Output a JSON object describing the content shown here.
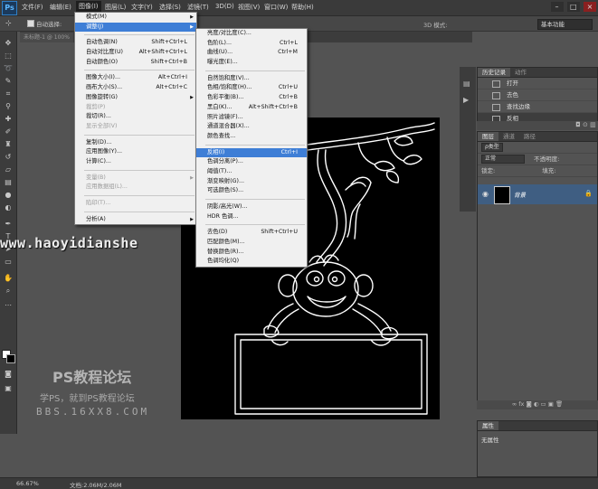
{
  "app": {
    "logo": "Ps"
  },
  "menubar": [
    "文件(F)",
    "编辑(E)",
    "图像(I)",
    "图层(L)",
    "文字(Y)",
    "选择(S)",
    "滤镜(T)",
    "3D(D)",
    "视图(V)",
    "窗口(W)",
    "帮助(H)"
  ],
  "window_controls": [
    "–",
    "□",
    "×"
  ],
  "options_bar": {
    "auto_select": "自动选择:",
    "mode_3d": "3D 模式:",
    "workspace": "基本功能"
  },
  "doc_tab": {
    "title": "未标题-1 @ 100%"
  },
  "image_menu": {
    "items": [
      {
        "label": "模式(M)",
        "shortcut": "",
        "submenu": true
      },
      {
        "label": "调整(J)",
        "shortcut": "",
        "submenu": true,
        "highlighted": true
      },
      {
        "sep": true
      },
      {
        "label": "自动色调(N)",
        "shortcut": "Shift+Ctrl+L"
      },
      {
        "label": "自动对比度(U)",
        "shortcut": "Alt+Shift+Ctrl+L"
      },
      {
        "label": "自动颜色(O)",
        "shortcut": "Shift+Ctrl+B"
      },
      {
        "sep": true
      },
      {
        "label": "图像大小(I)...",
        "shortcut": "Alt+Ctrl+I"
      },
      {
        "label": "画布大小(S)...",
        "shortcut": "Alt+Ctrl+C"
      },
      {
        "label": "图像旋转(G)",
        "shortcut": "",
        "submenu": true
      },
      {
        "label": "裁剪(P)",
        "shortcut": "",
        "disabled": true
      },
      {
        "label": "裁切(R)...",
        "shortcut": ""
      },
      {
        "label": "显示全部(V)",
        "shortcut": "",
        "disabled": true
      },
      {
        "sep": true
      },
      {
        "label": "复制(D)...",
        "shortcut": ""
      },
      {
        "label": "应用图像(Y)...",
        "shortcut": ""
      },
      {
        "label": "计算(C)...",
        "shortcut": ""
      },
      {
        "sep": true
      },
      {
        "label": "变量(B)",
        "shortcut": "",
        "submenu": true,
        "disabled": true
      },
      {
        "label": "应用数据组(L)...",
        "shortcut": "",
        "disabled": true
      },
      {
        "sep": true
      },
      {
        "label": "陷印(T)...",
        "shortcut": "",
        "disabled": true
      },
      {
        "sep": true
      },
      {
        "label": "分析(A)",
        "shortcut": "",
        "submenu": true
      }
    ]
  },
  "adjust_menu": {
    "items": [
      {
        "label": "亮度/对比度(C)...",
        "shortcut": ""
      },
      {
        "label": "色阶(L)...",
        "shortcut": "Ctrl+L"
      },
      {
        "label": "曲线(U)...",
        "shortcut": "Ctrl+M"
      },
      {
        "label": "曝光度(E)...",
        "shortcut": ""
      },
      {
        "sep": true
      },
      {
        "label": "自然饱和度(V)...",
        "shortcut": ""
      },
      {
        "label": "色相/饱和度(H)...",
        "shortcut": "Ctrl+U"
      },
      {
        "label": "色彩平衡(B)...",
        "shortcut": "Ctrl+B"
      },
      {
        "label": "黑白(K)...",
        "shortcut": "Alt+Shift+Ctrl+B"
      },
      {
        "label": "照片滤镜(F)...",
        "shortcut": ""
      },
      {
        "label": "通道混合器(X)...",
        "shortcut": ""
      },
      {
        "label": "颜色查找...",
        "shortcut": ""
      },
      {
        "sep": true
      },
      {
        "label": "反相(I)",
        "shortcut": "Ctrl+I",
        "highlighted": true
      },
      {
        "label": "色调分离(P)...",
        "shortcut": ""
      },
      {
        "label": "阈值(T)...",
        "shortcut": ""
      },
      {
        "label": "渐变映射(G)...",
        "shortcut": ""
      },
      {
        "label": "可选颜色(S)...",
        "shortcut": ""
      },
      {
        "sep": true
      },
      {
        "label": "阴影/高光(W)...",
        "shortcut": ""
      },
      {
        "label": "HDR 色调...",
        "shortcut": ""
      },
      {
        "sep": true
      },
      {
        "label": "去色(D)",
        "shortcut": "Shift+Ctrl+U"
      },
      {
        "label": "匹配颜色(M)...",
        "shortcut": ""
      },
      {
        "label": "替换颜色(R)...",
        "shortcut": ""
      },
      {
        "label": "色调均化(Q)",
        "shortcut": ""
      }
    ]
  },
  "history_panel": {
    "tabs": [
      "历史记录",
      "动作"
    ],
    "rows": [
      "打开",
      "去色",
      "查找边缘",
      "反相"
    ]
  },
  "layers_panel": {
    "tabs": [
      "图层",
      "通道",
      "路径"
    ],
    "kind_label": "ρ类型",
    "blend_mode": "正常",
    "opacity_label": "不透明度:",
    "lock_label": "锁定:",
    "fill_label": "填充:",
    "layer_name": "背景",
    "footer_icons": "∞  fx  ◙  ◐  ▭  ▣  🗑"
  },
  "properties_panel": {
    "title": "属性",
    "body": "无属性"
  },
  "status": {
    "zoom": "66.67%",
    "doc": "文档:2.06M/2.06M"
  },
  "watermark": {
    "url": "www.haoyidianshe",
    "big": "PS教程论坛",
    "sub": "学PS，就到PS教程论坛",
    "site": "BBS.16XX8.COM"
  },
  "colors": {
    "menu_highlight": "#3e7ed6",
    "ui_dark": "#3a3a3a",
    "layer_selected": "#3f5e82"
  }
}
